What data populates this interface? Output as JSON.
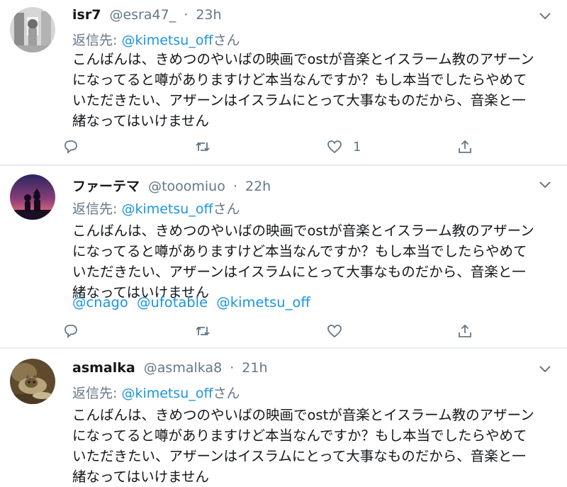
{
  "tweets": [
    {
      "name": "isr7",
      "handle": "@esra47_",
      "dot": "·",
      "time": "23h",
      "reply_prefix": "返信先: ",
      "reply_mention": "@kimetsu_off",
      "reply_suffix": "さん",
      "lines": [
        "こんばんは、きめつのやいばの映画でostが音楽とイスラーム教のアザーン",
        "になってると噂がありますけど本当なんですか？もし本当でしたらやめて",
        "いただきたい、アザーンはイスラムにとって大事なものだから、音楽と一",
        "緒なってはいけません"
      ],
      "mentions": [],
      "like_count": "1",
      "avatar": {
        "kind": "photo-gray",
        "colors": [
          "#9a9a9a",
          "#d9d9d9"
        ]
      }
    },
    {
      "name": "ファーテマ",
      "handle": "@tooomiuo",
      "dot": "·",
      "time": "22h",
      "reply_prefix": "返信先: ",
      "reply_mention": "@kimetsu_off",
      "reply_suffix": "さん",
      "lines": [
        "こんばんは、きめつのやいばの映画でostが音楽とイスラーム教のアザーン",
        "になってると噂がありますけど本当なんですか？もし本当でしたらやめて",
        "いただきたい、アザーンはイスラムにとって大事なものだから、音楽と一",
        "緒なってはいけません"
      ],
      "mentions": [
        "@cnago",
        "@ufotable",
        "@kimetsu_off"
      ],
      "like_count": "",
      "avatar": {
        "kind": "sunset-silhouette",
        "colors": [
          "#3b2a6b",
          "#e0647a"
        ]
      }
    },
    {
      "name": "asmalka",
      "handle": "@asmalka8",
      "dot": "·",
      "time": "21h",
      "reply_prefix": "返信先: ",
      "reply_mention": "@kimetsu_off",
      "reply_suffix": "さん",
      "lines": [
        "こんばんは、きめつのやいばの映画でostが音楽とイスラーム教のアザーン",
        "になってると噂がありますけど本当なんですか？もし本当でしたらやめて",
        "いただきたい、アザーンはイスラムにとって大事なものだから、音楽と一",
        "緒なってはいけません"
      ],
      "mentions": [],
      "like_count": "",
      "avatar": {
        "kind": "cat-photo",
        "colors": [
          "#6b5636",
          "#c8b58a"
        ]
      }
    }
  ],
  "icons": {
    "reply": "reply-icon",
    "retweet": "retweet-icon",
    "like": "like-icon",
    "share": "share-icon",
    "caret": "chevron-down-icon"
  },
  "colors": {
    "link": "#1b95e0",
    "muted": "#657786",
    "text": "#14171a",
    "divider": "#e6ecf0"
  }
}
